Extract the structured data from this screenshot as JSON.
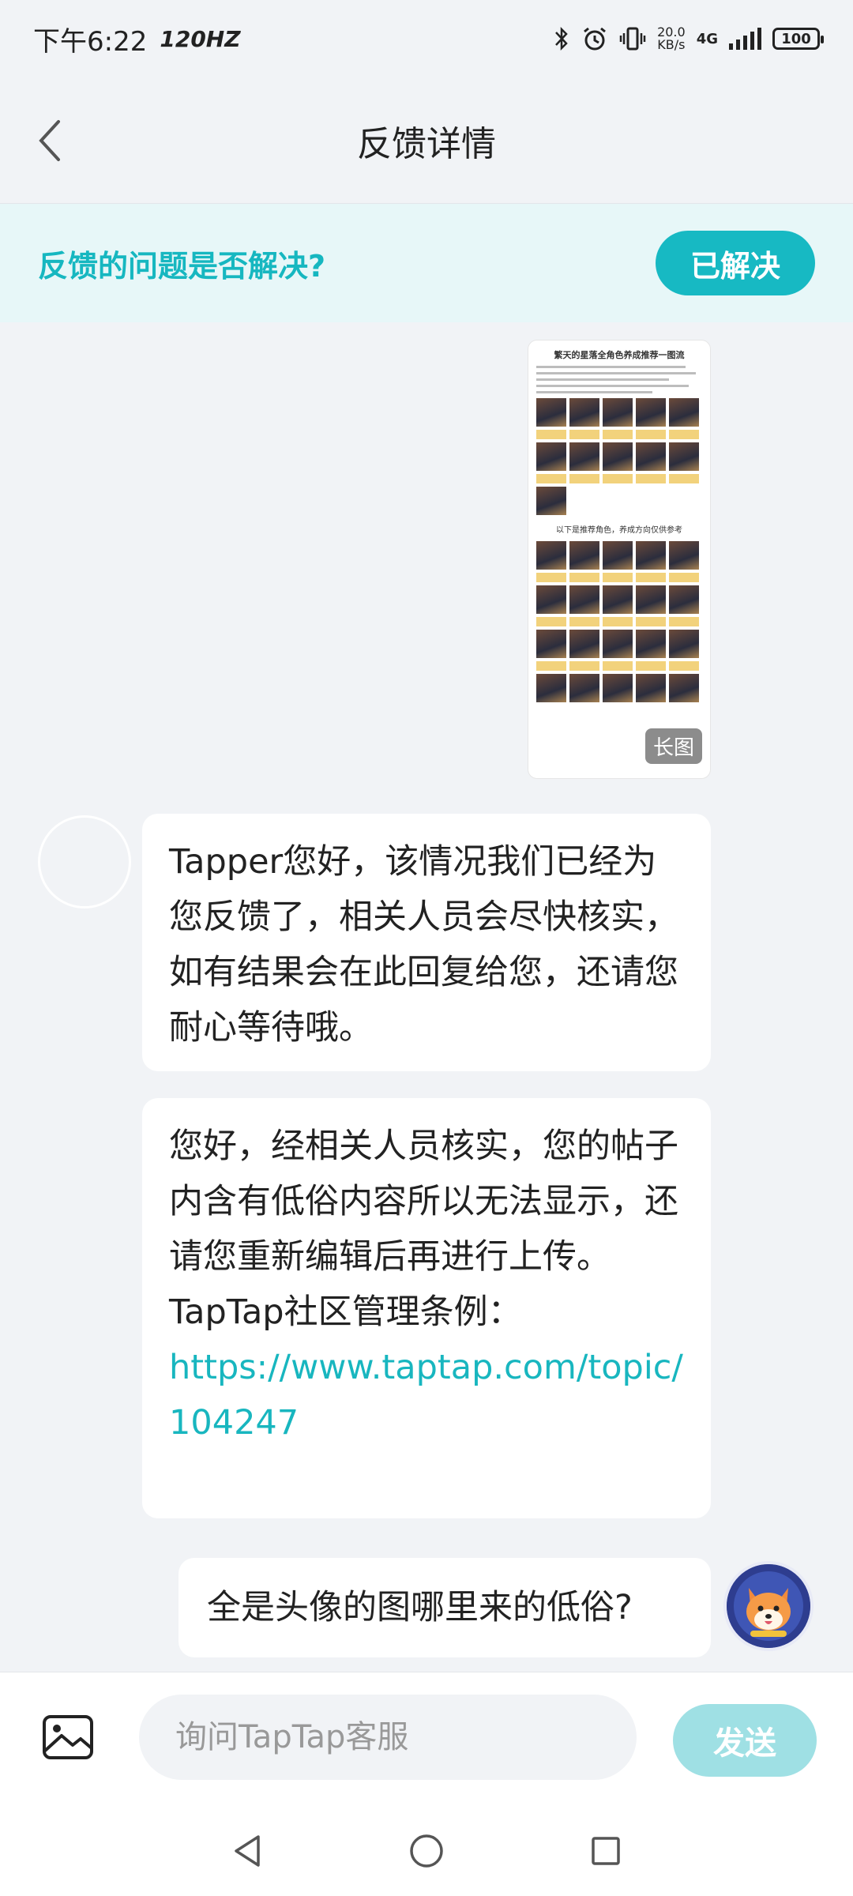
{
  "status_bar": {
    "time": "下午6:22",
    "refresh": "120HZ",
    "net_speed_value": "20.0",
    "net_speed_unit": "KB/s",
    "network": "4G",
    "battery": "100"
  },
  "header": {
    "title": "反馈详情",
    "back_icon": "chevron-left-icon"
  },
  "resolve_banner": {
    "question": "反馈的问题是否解决?",
    "button_label": "已解决"
  },
  "attachment": {
    "title": "繁天的星落全角色养成推荐一图流",
    "mid_caption": "以下是推荐角色，养成方向仅供参考",
    "badge": "长图"
  },
  "messages": [
    {
      "from": "agent",
      "text": "Tapper您好，该情况我们已经为您反馈了，相关人员会尽快核实，如有结果会在此回复给您，还请您耐心等待哦。"
    },
    {
      "from": "agent",
      "text": "您好，经相关人员核实，您的帖子内含有低俗内容所以无法显示，还请您重新编辑后再进行上传。",
      "rule_label": "TapTap社区管理条例：",
      "link": "https://www.taptap.com/topic/104247"
    },
    {
      "from": "user",
      "text": "全是头像的图哪里来的低俗?"
    }
  ],
  "input_bar": {
    "placeholder": "询问TapTap客服",
    "send_label": "发送",
    "image_icon": "image-icon"
  },
  "colors": {
    "accent": "#17b9c3",
    "banner_bg": "#e7f7f8",
    "link": "#18b6bf",
    "send_disabled": "#9fe0e4",
    "page_bg": "#f1f3f6"
  }
}
